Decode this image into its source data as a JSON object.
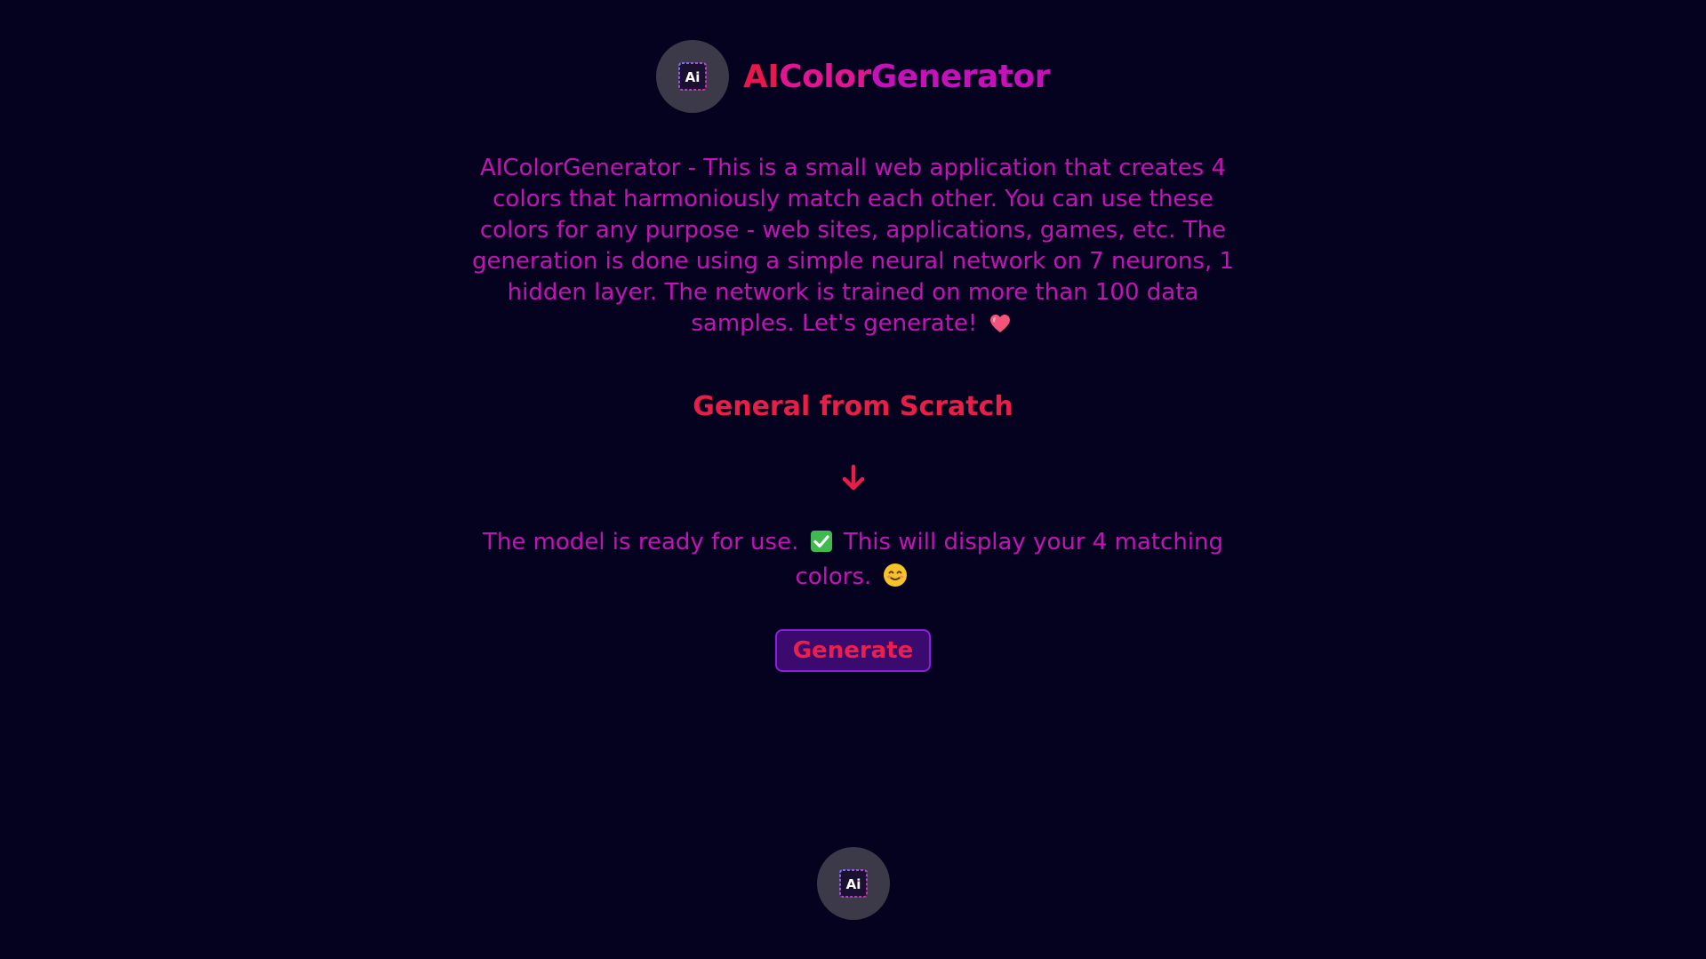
{
  "header": {
    "brand_part_a": "AI",
    "brand_part_b": "Color",
    "brand_part_c": "Generator",
    "logo_icon": "ai-grid-icon"
  },
  "description": "AIColorGenerator - This is a small web application that creates 4 colors that harmoniously match each other. You can use these colors for any purpose - web sites, applications, games, etc. The generation is done using a simple neural network on 7 neurons, 1 hidden layer. The network is trained on more than 100 data samples. Let's generate!",
  "description_emoji": "heart-icon",
  "section_title": "General from Scratch",
  "arrow_icon": "arrow-down-icon",
  "status": {
    "text_before": "The model is ready for use.",
    "text_after": "This will display your 4 matching colors.",
    "check_emoji": "check-mark-icon",
    "smile_emoji": "smiling-face-icon"
  },
  "generate_button_label": "Generate",
  "footer": {
    "logo_icon": "ai-grid-icon"
  },
  "colors": {
    "background": "#05021f",
    "primary_red": "#e81e48",
    "magenta": "#c214b4",
    "button_bg": "#3a0a6e",
    "button_border": "#8c1ee0",
    "logo_circle": "#3c3a48"
  }
}
